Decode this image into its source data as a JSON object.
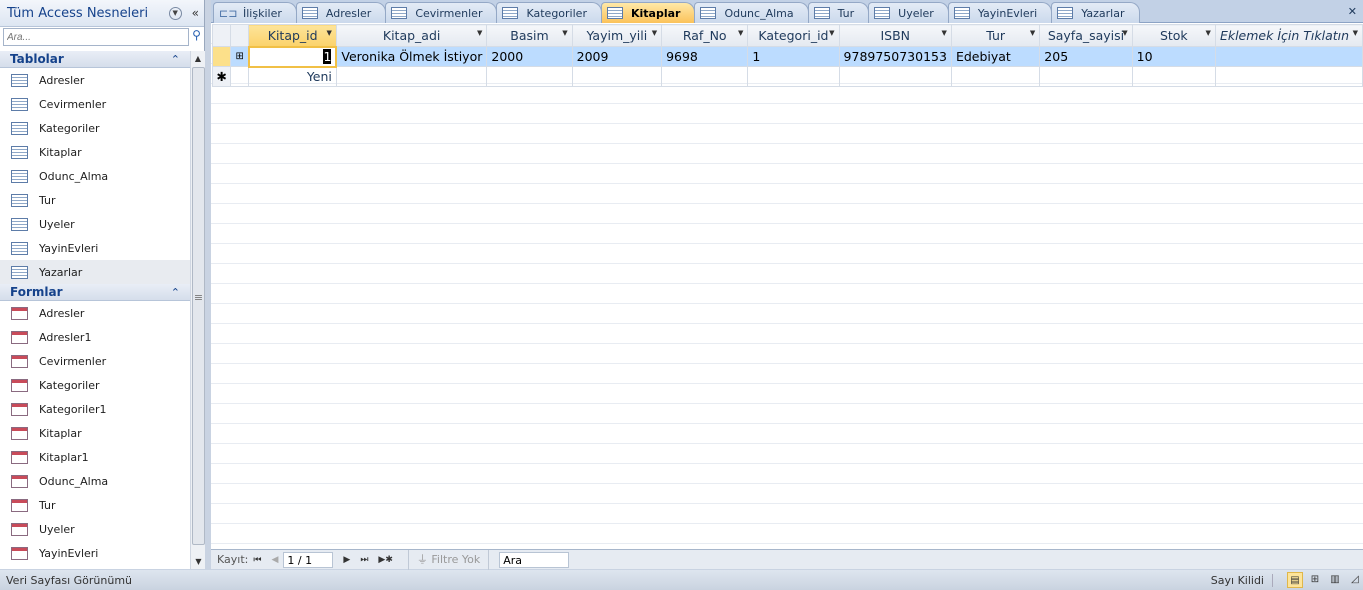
{
  "nav": {
    "title": "Tüm Access Nesneleri",
    "search_placeholder": "Ara...",
    "groups": [
      {
        "label": "Tablolar",
        "type": "table",
        "items": [
          "Adresler",
          "Cevirmenler",
          "Kategoriler",
          "Kitaplar",
          "Odunc_Alma",
          "Tur",
          "Uyeler",
          "YayinEvleri",
          "Yazarlar"
        ],
        "selected": "Yazarlar"
      },
      {
        "label": "Formlar",
        "type": "form",
        "items": [
          "Adresler",
          "Adresler1",
          "Cevirmenler",
          "Kategoriler",
          "Kategoriler1",
          "Kitaplar",
          "Kitaplar1",
          "Odunc_Alma",
          "Tur",
          "Uyeler",
          "YayinEvleri"
        ]
      }
    ]
  },
  "tabs": [
    {
      "label": "İlişkiler",
      "kind": "relationships"
    },
    {
      "label": "Adresler"
    },
    {
      "label": "Cevirmenler"
    },
    {
      "label": "Kategoriler"
    },
    {
      "label": "Kitaplar",
      "active": true
    },
    {
      "label": "Odunc_Alma"
    },
    {
      "label": "Tur"
    },
    {
      "label": "Uyeler"
    },
    {
      "label": "YayinEvleri"
    },
    {
      "label": "Yazarlar"
    }
  ],
  "table": {
    "columns": [
      "Kitap_id",
      "Kitap_adi",
      "Basim",
      "Yayim_yili",
      "Raf_No",
      "Kategori_id",
      "ISBN",
      "Tur",
      "Sayfa_sayisi",
      "Stok"
    ],
    "add_column_label": "Eklemek İçin Tıklatın",
    "rows": [
      [
        "1",
        "Veronika Ölmek İstiyor",
        "2000",
        "2009",
        "9698",
        "1",
        "9789750730153",
        "Edebiyat",
        "205",
        "10"
      ]
    ],
    "new_row_label": "Yeni"
  },
  "navbar": {
    "record_label": "Kayıt:",
    "record_value": "1 / 1",
    "filter_label": "Filtre Yok",
    "search_value": "Ara"
  },
  "status": {
    "left": "Veri Sayfası Görünümü",
    "right": "Sayı Kilidi"
  }
}
